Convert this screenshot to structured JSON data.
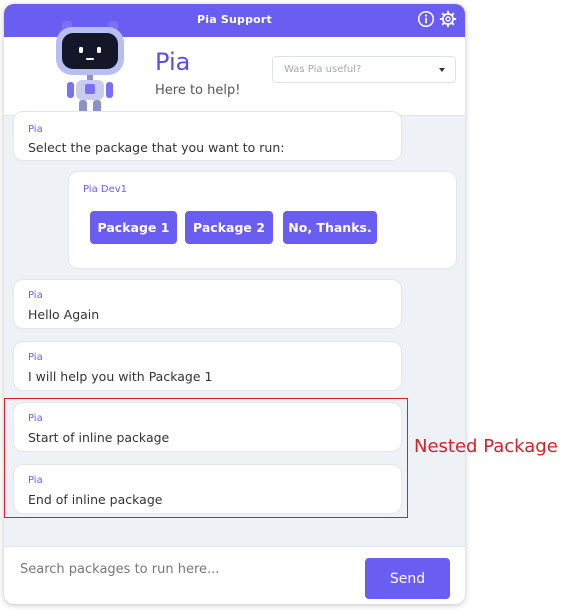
{
  "window": {
    "title": "Pia Support"
  },
  "header": {
    "bot_name": "Pia",
    "tagline": "Here to help!",
    "feedback_placeholder": "Was Pia useful?"
  },
  "messages": [
    {
      "sender": "Pia",
      "text": "Select the package that you want to run:"
    },
    {
      "sender": "Pia Dev1",
      "options": [
        "Package 1",
        "Package 2",
        "No, Thanks."
      ]
    },
    {
      "sender": "Pia",
      "text": "Hello Again"
    },
    {
      "sender": "Pia",
      "text": "I will help you with Package 1"
    },
    {
      "sender": "Pia",
      "text": "Start of inline package"
    },
    {
      "sender": "Pia",
      "text": "End of inline package"
    }
  ],
  "composer": {
    "placeholder": "Search packages to run here...",
    "send_label": "Send"
  },
  "annotation": {
    "label": "Nested Package",
    "color": "#d6202a"
  },
  "colors": {
    "accent": "#6a5ef2",
    "background": "#eef1f6"
  },
  "icons": {
    "info": "info-icon",
    "settings": "gear-icon",
    "dropdown": "chevron-down-icon"
  }
}
